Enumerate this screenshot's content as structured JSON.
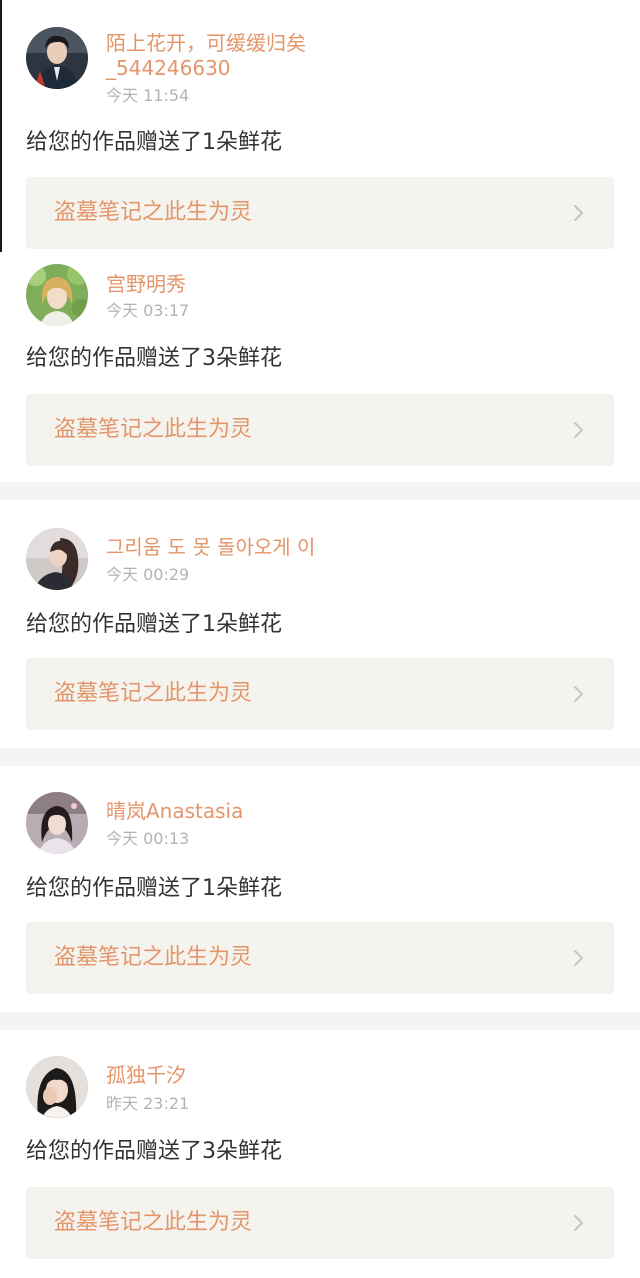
{
  "colors": {
    "accent": "#e4956a",
    "message_text": "#333333",
    "timestamp_text": "#b3b3b3",
    "link_background": "#f4f3ee",
    "page_background": "#f4f4f4"
  },
  "notifications": [
    {
      "username_line1": "陌上花开，可缓缓归矣",
      "username_line2": "_544246630",
      "time": "今天 11:54",
      "message": "给您的作品赠送了1朵鲜花",
      "work_title": "盗墓笔记之此生为灵",
      "avatar_icon": "avatar-boy-in-jacket"
    },
    {
      "username_line1": "宫野明秀",
      "time": "今天 03:17",
      "message": "给您的作品赠送了3朵鲜花",
      "work_title": "盗墓笔记之此生为灵",
      "avatar_icon": "avatar-girl-in-greenery"
    },
    {
      "username_line1": "그리움 도 못 돌아오게 이",
      "time": "今天 00:29",
      "message": "给您的作品赠送了1朵鲜花",
      "work_title": "盗墓笔记之此生为灵",
      "avatar_icon": "avatar-woman-profile"
    },
    {
      "username_line1": "晴岚Anastasia",
      "time": "今天 00:13",
      "message": "给您的作品赠送了1朵鲜花",
      "work_title": "盗墓笔记之此生为灵",
      "avatar_icon": "avatar-girl-dark-hair"
    },
    {
      "username_line1": "孤独千汐",
      "time": "昨天 23:21",
      "message": "给您的作品赠送了3朵鲜花",
      "work_title": "盗墓笔记之此生为灵",
      "avatar_icon": "avatar-girl-covering-face"
    }
  ]
}
